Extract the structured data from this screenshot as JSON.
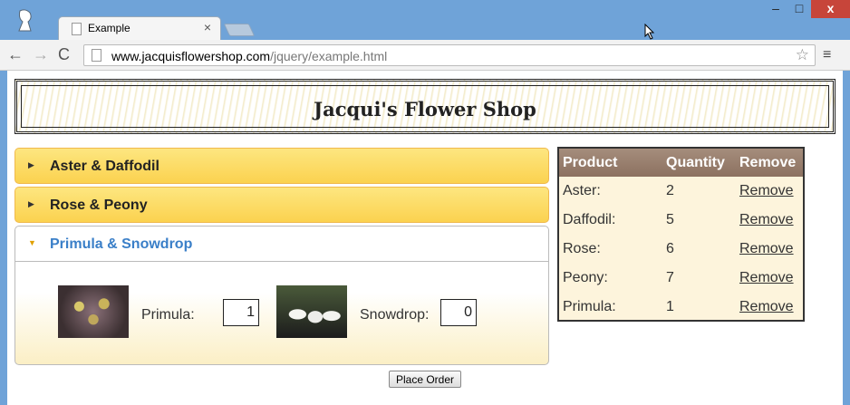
{
  "browser": {
    "tab_title": "Example",
    "tab_close": "×",
    "url_host": "www.jacquisflowershop.com",
    "url_path": "/jquery/example.html",
    "back_glyph": "←",
    "forward_glyph": "→",
    "reload_glyph": "C",
    "star_glyph": "☆",
    "menu_glyph": "≡",
    "min_glyph": "–",
    "max_glyph": "□",
    "close_glyph": "x"
  },
  "page": {
    "title": "Jacqui's Flower Shop",
    "accordion": [
      {
        "label": "Aster & Daffodil",
        "expanded": false
      },
      {
        "label": "Rose & Peony",
        "expanded": false
      },
      {
        "label": "Primula & Snowdrop",
        "expanded": true
      }
    ],
    "products": [
      {
        "label": "Primula:",
        "quantity": "1",
        "icon": "primula-flower-image"
      },
      {
        "label": "Snowdrop:",
        "quantity": "0",
        "icon": "snowdrop-flower-image"
      }
    ],
    "place_order_label": "Place Order"
  },
  "basket": {
    "headers": {
      "product": "Product",
      "quantity": "Quantity",
      "remove": "Remove"
    },
    "rows": [
      {
        "product": "Aster:",
        "quantity": "2",
        "remove": "Remove"
      },
      {
        "product": "Daffodil:",
        "quantity": "5",
        "remove": "Remove"
      },
      {
        "product": "Rose:",
        "quantity": "6",
        "remove": "Remove"
      },
      {
        "product": "Peony:",
        "quantity": "7",
        "remove": "Remove"
      },
      {
        "product": "Primula:",
        "quantity": "1",
        "remove": "Remove"
      }
    ]
  },
  "colors": {
    "accordion_header": "#fbd24f",
    "active_header_text": "#3a7fc8",
    "basket_header": "#9a8070",
    "basket_body": "#fdf4dc",
    "chrome_frame": "#6fa3d8"
  }
}
